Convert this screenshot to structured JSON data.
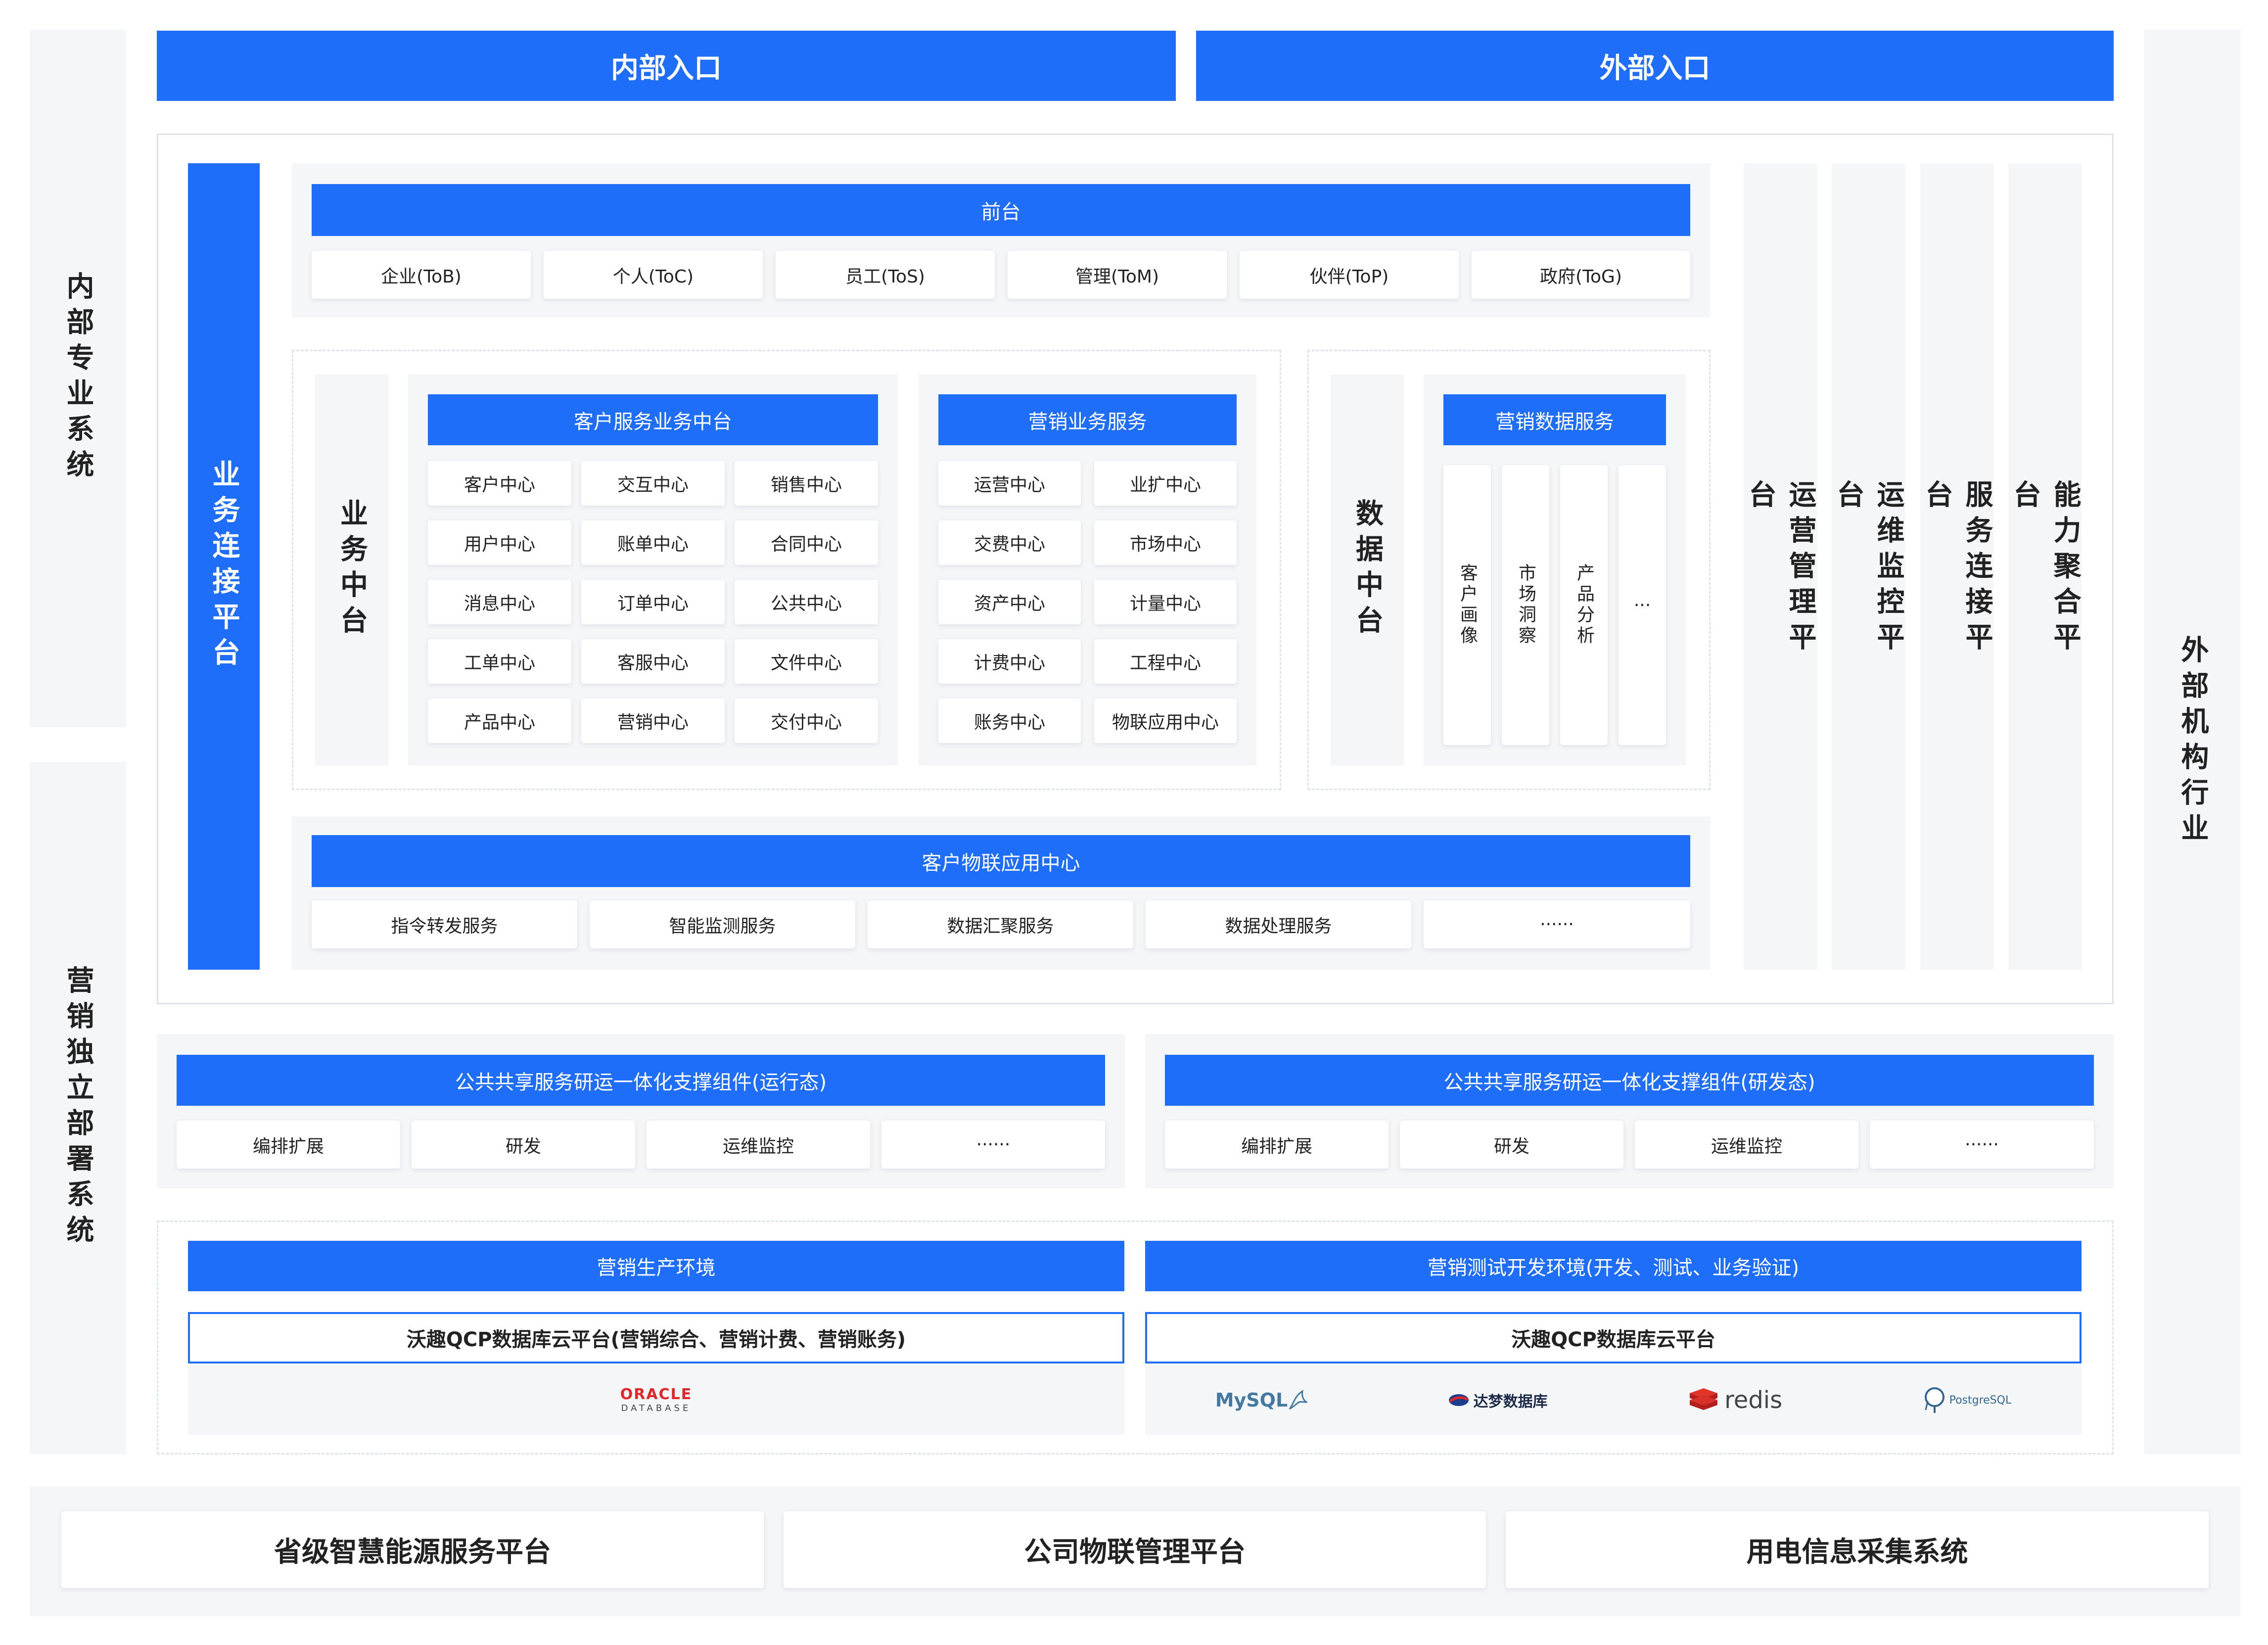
{
  "top": {
    "internal_entry": "内部入口",
    "external_entry": "外部入口"
  },
  "side": {
    "left_internal": "内部专业系统",
    "left_marketing": "营销独立部署系统",
    "right_external": "外部机构行业"
  },
  "business_connection": "业务连接平台",
  "frontend": {
    "title": "前台",
    "items": [
      "企业(ToB)",
      "个人(ToC)",
      "员工(ToS)",
      "管理(ToM)",
      "伙伴(ToP)",
      "政府(ToG)"
    ]
  },
  "business_middle": {
    "label": "业务中台",
    "customer_service": {
      "title": "客户服务业务中台",
      "items": [
        "客户中心",
        "交互中心",
        "销售中心",
        "用户中心",
        "账单中心",
        "合同中心",
        "消息中心",
        "订单中心",
        "公共中心",
        "工单中心",
        "客服中心",
        "文件中心",
        "产品中心",
        "营销中心",
        "交付中心"
      ]
    },
    "marketing_service": {
      "title": "营销业务服务",
      "items": [
        "运营中心",
        "业扩中心",
        "交费中心",
        "市场中心",
        "资产中心",
        "计量中心",
        "计费中心",
        "工程中心",
        "账务中心",
        "物联应用中心"
      ]
    }
  },
  "data_middle": {
    "label": "数据中台",
    "title": "营销数据服务",
    "items": [
      "客户画像",
      "市场洞察",
      "产品分析",
      "···"
    ]
  },
  "iot_center": {
    "title": "客户物联应用中心",
    "items": [
      "指令转发服务",
      "智能监测服务",
      "数据汇聚服务",
      "数据处理服务",
      "······"
    ]
  },
  "right_platforms": [
    "运营管理平台",
    "运维监控平台",
    "服务连接平台",
    "能力聚合平台"
  ],
  "shared_components": {
    "runtime": {
      "title": "公共共享服务研运一体化支撑组件(运行态)",
      "items": [
        "编排扩展",
        "研发",
        "运维监控",
        "······"
      ]
    },
    "dev": {
      "title": "公共共享服务研运一体化支撑组件(研发态)",
      "items": [
        "编排扩展",
        "研发",
        "运维监控",
        "······"
      ]
    }
  },
  "environments": {
    "production": {
      "title": "营销生产环境",
      "platform": "沃趣QCP数据库云平台(营销综合、营销计费、营销账务)",
      "logos": [
        {
          "icon": "oracle-logo",
          "text": "ORACLE",
          "sub": "DATABASE"
        }
      ]
    },
    "testing": {
      "title": "营销测试开发环境(开发、测试、业务验证)",
      "platform": "沃趣QCP数据库云平台",
      "logos": [
        {
          "icon": "mysql-logo",
          "text": "MySQL"
        },
        {
          "icon": "dameng-logo",
          "text": "达梦数据库"
        },
        {
          "icon": "redis-logo",
          "text": "redis"
        },
        {
          "icon": "postgresql-logo",
          "text": "PostgreSQL"
        }
      ]
    }
  },
  "bottom": [
    "省级智慧能源服务平台",
    "公司物联管理平台",
    "用电信息采集系统"
  ],
  "colors": {
    "primary_blue": "#1f6ef9",
    "panel_gray": "#f5f6f8"
  }
}
